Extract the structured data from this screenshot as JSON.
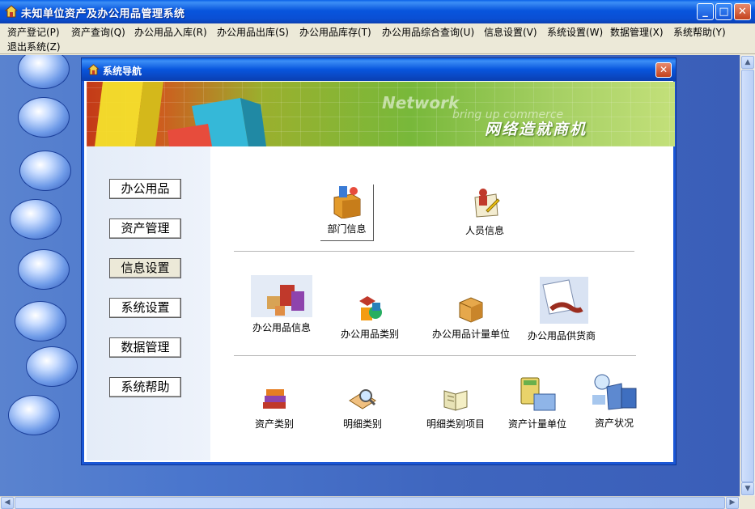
{
  "window": {
    "title": "未知单位资产及办公用品管理系统",
    "min_label": "_",
    "max_label": "□",
    "close_label": "✕"
  },
  "menu": [
    "资产登记(P)",
    "资产查询(Q)",
    "办公用品入库(R)",
    "办公用品出库(S)",
    "办公用品库存(T)",
    "办公用品综合查询(U)",
    "信息设置(V)",
    "系统设置(W)",
    "数据管理(X)",
    "系统帮助(Y)",
    "退出系统(Z)"
  ],
  "dialog": {
    "title": "系统导航",
    "close_label": "✕",
    "banner": {
      "network": "Network",
      "bring": "bring up commerce",
      "slogan": "网络造就商机"
    }
  },
  "nav_buttons": [
    "办公用品",
    "资产管理",
    "信息设置",
    "系统设置",
    "数据管理",
    "系统帮助"
  ],
  "active_nav": "信息设置",
  "tiles": {
    "row1": [
      "部门信息",
      "人员信息"
    ],
    "row2": [
      "办公用品信息",
      "办公用品类别",
      "办公用品计量单位",
      "办公用品供货商"
    ],
    "row3": [
      "资产类别",
      "明细类别",
      "明细类别项目",
      "资产计量单位",
      "资产状况"
    ]
  },
  "colors": {
    "titlebar": "#0855dd",
    "desktop": "#4a76cd",
    "banner_green": "#78b83a"
  }
}
